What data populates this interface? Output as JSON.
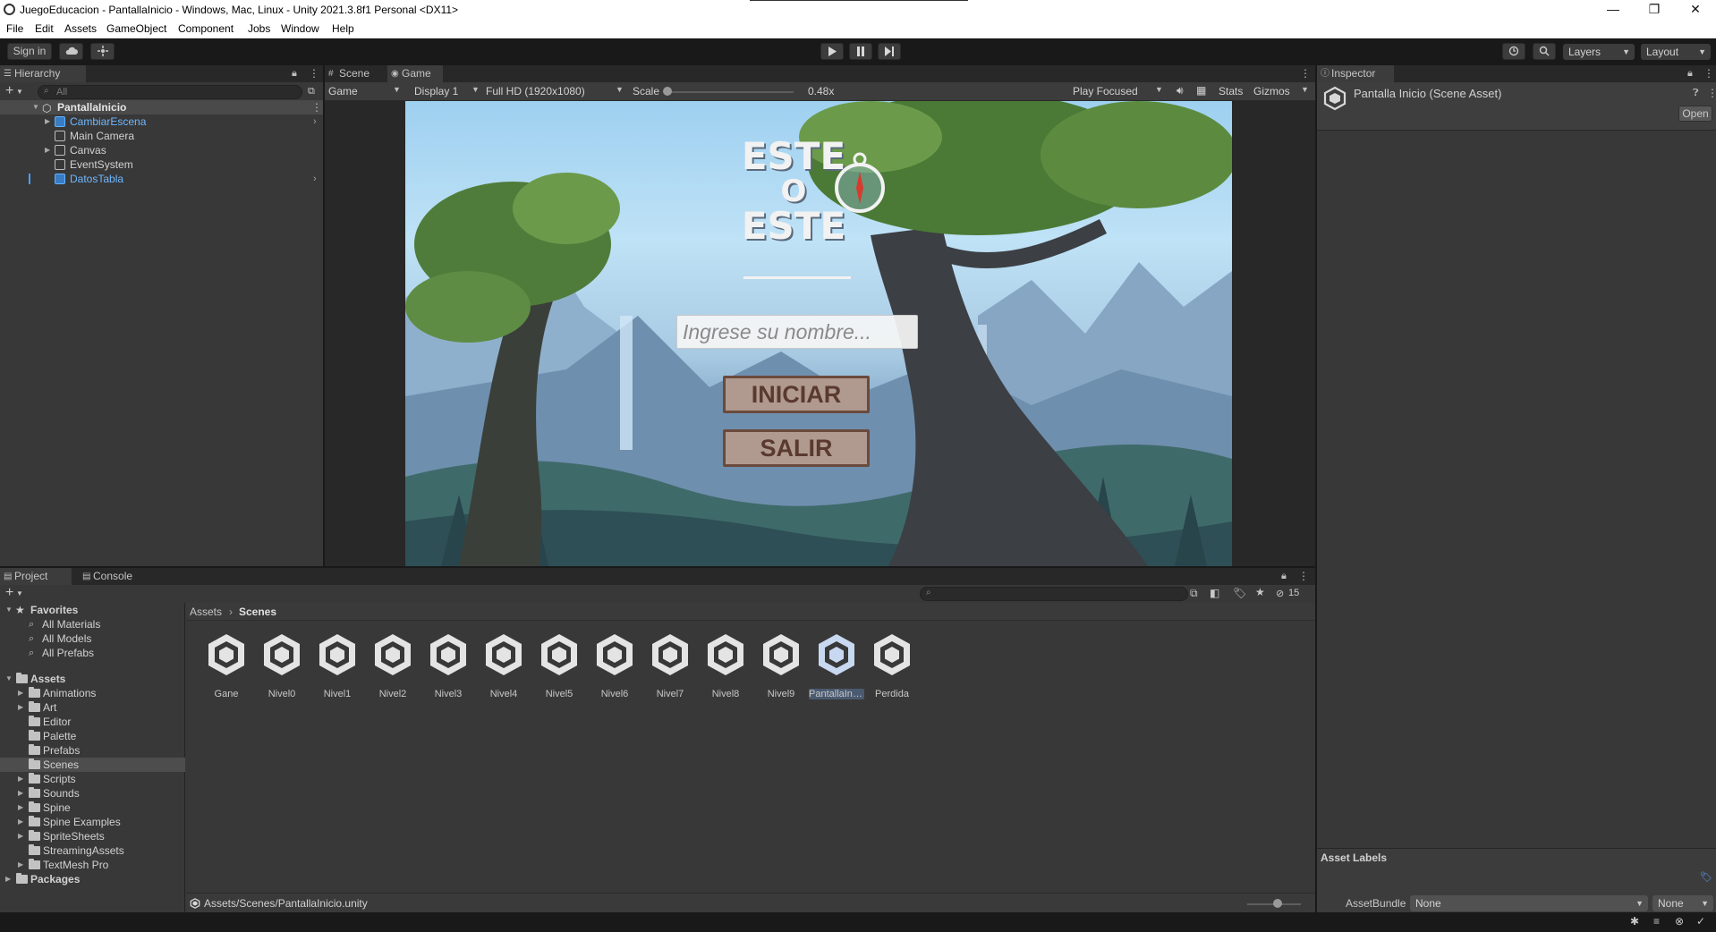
{
  "window": {
    "title": "JuegoEducacion - PantallaInicio - Windows, Mac, Linux - Unity 2021.3.8f1 Personal <DX11>",
    "controls": {
      "minimize": "—",
      "restore": "❐",
      "close": "✕"
    }
  },
  "menu": [
    "File",
    "Edit",
    "Assets",
    "GameObject",
    "Component",
    "Jobs",
    "Window",
    "Help"
  ],
  "toolbar": {
    "sign_in": "Sign in",
    "play_icon": "play-icon",
    "pause_icon": "pause-icon",
    "step_icon": "step-icon",
    "layers": "Layers",
    "layout": "Layout"
  },
  "hierarchy": {
    "tab": "Hierarchy",
    "search_placeholder": "All",
    "scene": "PantallaInicio",
    "items": [
      {
        "label": "CambiarEscena",
        "prefab": true,
        "expandable": true
      },
      {
        "label": "Main Camera",
        "prefab": false,
        "expandable": false
      },
      {
        "label": "Canvas",
        "prefab": false,
        "expandable": true
      },
      {
        "label": "EventSystem",
        "prefab": false,
        "expandable": false
      },
      {
        "label": "DatosTabla",
        "prefab": true,
        "expandable": false
      }
    ]
  },
  "scene_tabs": {
    "scene": "Scene",
    "game": "Game"
  },
  "game_toolbar": {
    "view": "Game",
    "display": "Display 1",
    "resolution": "Full HD (1920x1080)",
    "scale_label": "Scale",
    "scale_value": "0.48x",
    "scale_level": 0.0,
    "play_mode": "Play Focused",
    "stats": "Stats",
    "gizmos": "Gizmos"
  },
  "game": {
    "logo_line1": "ESTE",
    "logo_line2": "O",
    "logo_line3": "ESTE",
    "name_placeholder": "Ingrese su nombre...",
    "start_button": "INICIAR",
    "exit_button": "SALIR"
  },
  "inspector": {
    "tab": "Inspector",
    "asset_title": "Pantalla Inicio (Scene Asset)",
    "open_button": "Open",
    "asset_labels": "Asset Labels",
    "asset_bundle_label": "AssetBundle",
    "asset_bundle_value": "None",
    "asset_variant_value": "None"
  },
  "project": {
    "tab_project": "Project",
    "tab_console": "Console",
    "hidden_count": "15",
    "favorites": {
      "label": "Favorites",
      "items": [
        "All Materials",
        "All Models",
        "All Prefabs"
      ]
    },
    "assets": {
      "label": "Assets",
      "items": [
        {
          "label": "Animations",
          "expandable": true
        },
        {
          "label": "Art",
          "expandable": true
        },
        {
          "label": "Editor",
          "expandable": false
        },
        {
          "label": "Palette",
          "expandable": false
        },
        {
          "label": "Prefabs",
          "expandable": false
        },
        {
          "label": "Scenes",
          "expandable": false
        },
        {
          "label": "Scripts",
          "expandable": true
        },
        {
          "label": "Sounds",
          "expandable": true
        },
        {
          "label": "Spine",
          "expandable": true
        },
        {
          "label": "Spine Examples",
          "expandable": true
        },
        {
          "label": "SpriteSheets",
          "expandable": true
        },
        {
          "label": "StreamingAssets",
          "expandable": false
        },
        {
          "label": "TextMesh Pro",
          "expandable": true
        }
      ]
    },
    "packages": "Packages",
    "breadcrumb": [
      "Assets",
      "Scenes"
    ],
    "scenes": [
      "Gane",
      "Nivel0",
      "Nivel1",
      "Nivel2",
      "Nivel3",
      "Nivel4",
      "Nivel5",
      "Nivel6",
      "Nivel7",
      "Nivel8",
      "Nivel9",
      "PantallaInic...",
      "Perdida"
    ],
    "selected_path": "Assets/Scenes/PantallaInicio.unity"
  },
  "colors": {
    "toolbar_bg": "#191919",
    "panel_bg": "#383838",
    "tab_bg": "#282828",
    "prefab_text": "#6fb7ff",
    "selection": "#4d4d4d"
  }
}
